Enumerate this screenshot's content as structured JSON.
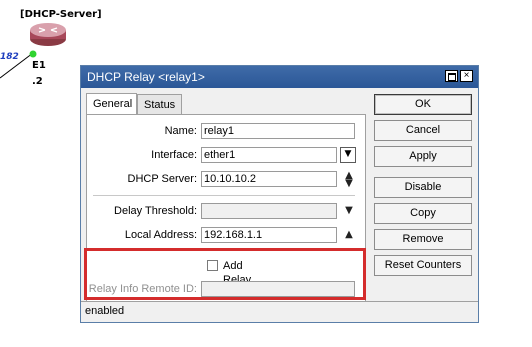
{
  "topology": {
    "server_label": "[DHCP-Server]",
    "interface_label": "E1",
    "address_label": ".2",
    "link_label": "182"
  },
  "window": {
    "title": "DHCP Relay <relay1>",
    "maximize_icon": "maximize-icon",
    "close_glyph": "×"
  },
  "tabs": [
    {
      "label": "General",
      "active": true
    },
    {
      "label": "Status",
      "active": false
    }
  ],
  "form": {
    "name": {
      "label": "Name:",
      "value": "relay1"
    },
    "interface": {
      "label": "Interface:",
      "value": "ether1"
    },
    "dhcp_server": {
      "label": "DHCP Server:",
      "value": "10.10.10.2"
    },
    "delay_threshold": {
      "label": "Delay Threshold:",
      "value": ""
    },
    "local_address": {
      "label": "Local Address:",
      "value": "192.168.1.1"
    },
    "add_relay_info": {
      "label": "Add Relay Info",
      "checked": false
    },
    "relay_info_remote_id": {
      "label": "Relay Info Remote ID:",
      "value": ""
    }
  },
  "buttons": {
    "ok": "OK",
    "cancel": "Cancel",
    "apply": "Apply",
    "disable": "Disable",
    "copy": "Copy",
    "remove": "Remove",
    "reset_counters": "Reset Counters"
  },
  "status": {
    "text": "enabled"
  },
  "colors": {
    "highlight": "#d42c2c",
    "titlebar": "#2b5797"
  }
}
